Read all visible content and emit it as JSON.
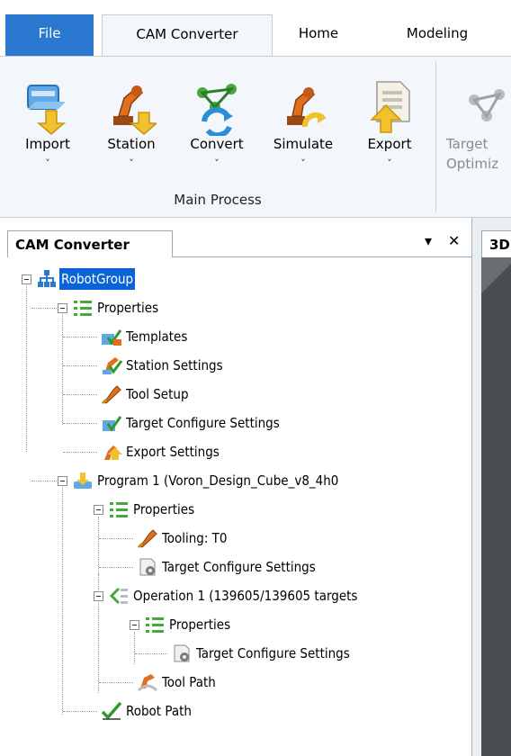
{
  "ribbon_tabs": {
    "file": "File",
    "cam_converter": "CAM Converter",
    "home": "Home",
    "modeling": "Modeling"
  },
  "ribbon": {
    "buttons": [
      {
        "label": "Import",
        "chevron": "˅",
        "icon": "import-icon"
      },
      {
        "label": "Station",
        "chevron": "˅",
        "icon": "station-robot-icon"
      },
      {
        "label": "Convert",
        "chevron": "˅",
        "icon": "convert-icon"
      },
      {
        "label": "Simulate",
        "chevron": "˅",
        "icon": "simulate-icon"
      },
      {
        "label": "Export",
        "chevron": "˅",
        "icon": "export-icon"
      },
      {
        "label": "Target",
        "label2": "Optimiz",
        "icon": "target-optimize-icon"
      }
    ],
    "group_label": "Main Process"
  },
  "panel": {
    "title": "CAM Converter",
    "pin_glyph": "▾",
    "close_glyph": "✕",
    "doc_tab": "3D"
  },
  "tree": {
    "root": "RobotGroup",
    "properties_1": "Properties",
    "templates": "Templates",
    "station_settings": "Station Settings",
    "tool_setup": "Tool Setup",
    "target_configure_1": "Target Configure Settings",
    "export_settings": "Export Settings",
    "program": "Program 1 (Voron_Design_Cube_v8_4h0",
    "properties_2": "Properties",
    "tooling": "Tooling: T0",
    "target_configure_2": "Target Configure Settings",
    "operation": "Operation 1 (139605/139605 targets",
    "properties_3": "Properties",
    "target_configure_3": "Target Configure Settings",
    "tool_path": "Tool Path",
    "robot_path": "Robot Path"
  },
  "colors": {
    "accent": "#2b78d0",
    "selection": "#0a64d8",
    "ribbon_bg": "#f3f7fb"
  }
}
